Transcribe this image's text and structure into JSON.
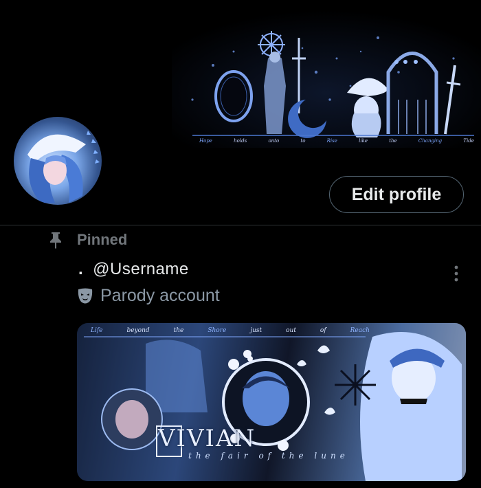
{
  "banner": {
    "words": [
      "Hope",
      "holds",
      "onto",
      "to",
      "Rise",
      "like",
      "the",
      "Changing",
      "Tide"
    ]
  },
  "profile": {
    "edit_label": "Edit profile"
  },
  "pinned": {
    "label": "Pinned",
    "icon": "pin-icon"
  },
  "tweet": {
    "bullet": ".",
    "username": "@Username",
    "parody_label": "Parody account",
    "parody_icon": "theater-mask-icon",
    "more_icon": "more-vertical-icon",
    "media": {
      "words": [
        "Life",
        "beyond",
        "the",
        "Shore",
        "just",
        "out",
        "of",
        "Reach"
      ],
      "title": "VIVIAN",
      "subtitle": "the fair of the lune"
    }
  },
  "colors": {
    "background": "#000000",
    "divider": "#2f3336",
    "muted_text": "#71767b",
    "accent_blue": "#7fa8ff"
  }
}
